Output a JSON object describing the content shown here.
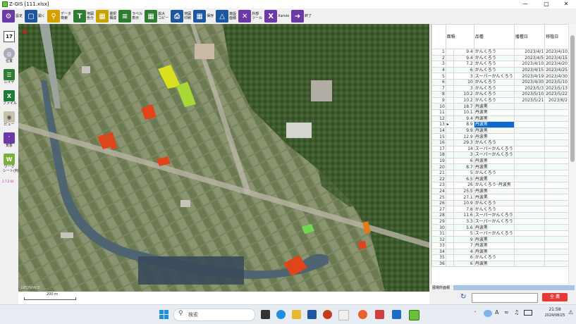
{
  "window": {
    "title": "Z-GIS [111.xlsx]"
  },
  "toolbar": {
    "items": [
      {
        "label": "設定",
        "icon": "gear-icon",
        "color": "#6b3aa8"
      },
      {
        "label": "開く",
        "icon": "folder-icon",
        "color": "#1e56a0"
      },
      {
        "label": "データ\n検索",
        "icon": "magnifier-icon",
        "color": "#d6a000"
      },
      {
        "label": "地図\n色分",
        "icon": "map-color-icon",
        "color": "#2e7d32"
      },
      {
        "label": "選択\n構成",
        "icon": "select-icon",
        "color": "#c8a200"
      },
      {
        "label": "ラベル\n表示",
        "icon": "label-icon",
        "color": "#2e7d32"
      },
      {
        "label": "拡大\nコピー",
        "icon": "zoom-copy-icon",
        "color": "#2e7d32"
      },
      {
        "label": "地図\n印刷",
        "icon": "printer-icon",
        "color": "#1e56a0"
      },
      {
        "label": "保存",
        "icon": "save-icon",
        "color": "#1e56a0"
      },
      {
        "label": "施設\n面積",
        "icon": "measure-icon",
        "color": "#1e56a0"
      },
      {
        "label": "外部\nツール",
        "icon": "tools-icon",
        "color": "#6b3aa8"
      },
      {
        "label": "Xarvio",
        "icon": "xarvio-icon",
        "color": "#6b3aa8"
      },
      {
        "label": "終了",
        "icon": "exit-icon",
        "color": "#6b3aa8"
      }
    ]
  },
  "sidebar": {
    "zoom": "17",
    "items": [
      {
        "label": "位置",
        "icon": "globe-icon"
      },
      {
        "label": "レイヤ",
        "icon": "layers-icon"
      },
      {
        "label": "ファイル",
        "icon": "excel-file-icon"
      },
      {
        "label": "ビュー",
        "icon": "eye-icon"
      },
      {
        "label": "気象",
        "icon": "thermometer-icon"
      },
      {
        "label": "ワーク\nシート(判)",
        "icon": "worksheet-icon"
      }
    ],
    "version": "2.7.2.64"
  },
  "map": {
    "scale_label": "200 m",
    "attribution": "GEOSPACE",
    "highlight_colors": {
      "yellow": "#d8e020",
      "lime": "#a8d836",
      "orange": "#e0451a",
      "green": "#70d850"
    }
  },
  "grid": {
    "columns": [
      "面積",
      "品種",
      "播種日",
      "移植日"
    ],
    "rows": [
      {
        "n": "1",
        "area": "9.4",
        "variety": "かんくろう",
        "sow": "2023/4/1",
        "trans": "2023/4/10"
      },
      {
        "n": "2",
        "area": "9.4",
        "variety": "かんくろう",
        "sow": "2023/4/5",
        "trans": "2023/4/15"
      },
      {
        "n": "3",
        "area": "7.2",
        "variety": "かんくろう",
        "sow": "2023/4/10",
        "trans": "2023/4/20"
      },
      {
        "n": "4",
        "area": "6",
        "variety": "かんくろう",
        "sow": "2023/4/15",
        "trans": "2023/4/25"
      },
      {
        "n": "5",
        "area": "3",
        "variety": "スーパーかんくろう",
        "sow": "2023/4/19",
        "trans": "2023/4/30"
      },
      {
        "n": "6",
        "area": "10",
        "variety": "かんくろう",
        "sow": "2023/4/30",
        "trans": "2023/5/10"
      },
      {
        "n": "7",
        "area": "3",
        "variety": "かんくろう",
        "sow": "2023/5/3",
        "trans": "2023/5/13"
      },
      {
        "n": "8",
        "area": "10.2",
        "variety": "かんくろう",
        "sow": "2023/5/10",
        "trans": "2023/5/22"
      },
      {
        "n": "9",
        "area": "10.2",
        "variety": "かんくろう",
        "sow": "2023/5/21",
        "trans": "2023/6/2"
      },
      {
        "n": "10",
        "area": "18.7",
        "variety": "丹波黒",
        "sow": "",
        "trans": ""
      },
      {
        "n": "11",
        "area": "10.1",
        "variety": "丹波黒",
        "sow": "",
        "trans": ""
      },
      {
        "n": "12",
        "area": "9.4",
        "variety": "丹波黒",
        "sow": "",
        "trans": ""
      },
      {
        "n": "13",
        "area": "8.9",
        "variety": "丹波黒",
        "sow": "",
        "trans": ""
      },
      {
        "n": "14",
        "area": "9.9",
        "variety": "丹波黒",
        "sow": "",
        "trans": ""
      },
      {
        "n": "15",
        "area": "12.9",
        "variety": "丹波黒",
        "sow": "",
        "trans": ""
      },
      {
        "n": "16",
        "area": "29.3",
        "variety": "かんくろう",
        "sow": "",
        "trans": ""
      },
      {
        "n": "17",
        "area": "14",
        "variety": "スーパーかんくろう",
        "sow": "",
        "trans": ""
      },
      {
        "n": "18",
        "area": "3",
        "variety": "スーパーかんくろう",
        "sow": "",
        "trans": ""
      },
      {
        "n": "19",
        "area": "6",
        "variety": "丹波黒",
        "sow": "",
        "trans": ""
      },
      {
        "n": "20",
        "area": "8.7",
        "variety": "丹波黒",
        "sow": "",
        "trans": ""
      },
      {
        "n": "21",
        "area": "5",
        "variety": "かんくろう",
        "sow": "",
        "trans": ""
      },
      {
        "n": "22",
        "area": "6.5",
        "variety": "丹波黒",
        "sow": "",
        "trans": ""
      },
      {
        "n": "23",
        "area": "26",
        "variety": "かんくろう･丹波黒",
        "sow": "",
        "trans": ""
      },
      {
        "n": "24",
        "area": "25.5",
        "variety": "丹波黒",
        "sow": "",
        "trans": ""
      },
      {
        "n": "25",
        "area": "27.1",
        "variety": "丹波黒",
        "sow": "",
        "trans": ""
      },
      {
        "n": "26",
        "area": "10.9",
        "variety": "かんくろう",
        "sow": "",
        "trans": ""
      },
      {
        "n": "27",
        "area": "7.8",
        "variety": "かんくろう",
        "sow": "",
        "trans": ""
      },
      {
        "n": "28",
        "area": "11.6",
        "variety": "スーパーかんくろう",
        "sow": "",
        "trans": ""
      },
      {
        "n": "29",
        "area": "3.3",
        "variety": "スーパーかんくろう",
        "sow": "",
        "trans": ""
      },
      {
        "n": "30",
        "area": "5.6",
        "variety": "丹波黒",
        "sow": "",
        "trans": ""
      },
      {
        "n": "31",
        "area": "5",
        "variety": "スーパーかんくろう",
        "sow": "",
        "trans": ""
      },
      {
        "n": "32",
        "area": "9",
        "variety": "丹波黒",
        "sow": "",
        "trans": ""
      },
      {
        "n": "33",
        "area": "7",
        "variety": "丹波黒",
        "sow": "",
        "trans": ""
      },
      {
        "n": "34",
        "area": "4",
        "variety": "丹波黒",
        "sow": "",
        "trans": ""
      },
      {
        "n": "35",
        "area": "6",
        "variety": "かんくろう",
        "sow": "",
        "trans": ""
      },
      {
        "n": "36",
        "area": "6",
        "variety": "丹波黒",
        "sow": "",
        "trans": ""
      }
    ],
    "selected_row": 13
  },
  "bottom": {
    "area_label": "圃場所面積",
    "button_label": "全 農"
  },
  "taskbar": {
    "search_placeholder": "検索",
    "time": "21:58",
    "date": "2024/08/25",
    "ime": "A"
  }
}
